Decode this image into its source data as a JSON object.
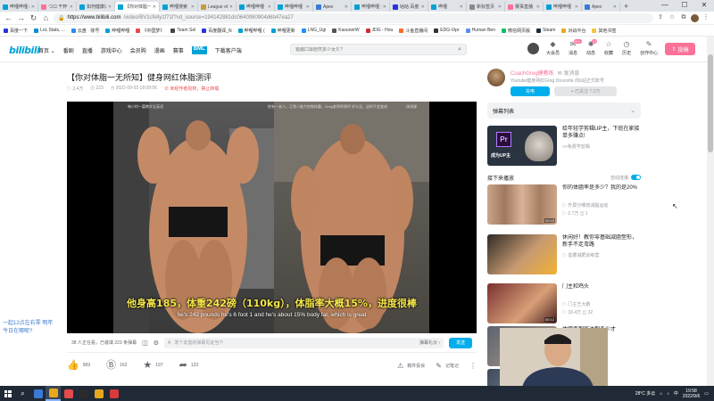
{
  "browser": {
    "tabs": [
      {
        "label": "哔哩哔哩 (゜-゜)つロ",
        "color": "#00a1d6"
      },
      {
        "label": "つロ 干杯~",
        "color": "#fb7299"
      },
      {
        "label": "如何健康过量减脂",
        "color": "#00a1d6"
      },
      {
        "label": "【你对体脂一无所知】健身网红体脂测评",
        "color": "#00a1d6",
        "active": true
      },
      {
        "label": "哔哩搜索",
        "color": "#00a1d6"
      },
      {
        "label": "League of Legend",
        "color": "#c89b3c"
      },
      {
        "label": "哔哩哔哩",
        "color": "#00a1d6"
      },
      {
        "label": "哔哩哔哩",
        "color": "#00a1d6"
      },
      {
        "label": "Apex",
        "color": "#3a7bd5"
      },
      {
        "label": "哔哩哔哩 好像",
        "color": "#00a1d6"
      },
      {
        "label": "咕咕 百度",
        "color": "#2932e1"
      },
      {
        "label": "哔哩",
        "color": "#00a1d6"
      },
      {
        "label": "新标签页",
        "color": "#888888"
      },
      {
        "label": "赛事直播",
        "color": "#fb7299"
      },
      {
        "label": "哔哩哔哩",
        "color": "#00a1d6"
      },
      {
        "label": "Apex",
        "color": "#3a7bd5"
      }
    ],
    "new_tab": "+",
    "window_controls": [
      "—",
      "☐",
      "✕"
    ],
    "url_host": "https://www.bilibili.com",
    "url_path": "/video/BV1cN4y1f71f?vd_source=194142881dc0640980904d6b47ea27",
    "bookmarks": [
      {
        "label": "百度一下",
        "color": "#2932e1"
      },
      {
        "label": "LoL Stats, ...",
        "color": "#0a8fd0"
      },
      {
        "label": "云盘 · 账号",
        "color": "#2d8cf0"
      },
      {
        "label": "哔哩哔哩",
        "color": "#00a1d6"
      },
      {
        "label": "《中国梦》",
        "color": "#e44b4b"
      },
      {
        "label": "Team Sel",
        "color": "#444444"
      },
      {
        "label": "百度翻译_N",
        "color": "#2932e1"
      },
      {
        "label": "哔哩哔哩 (",
        "color": "#00a1d6"
      },
      {
        "label": "哔哩更新",
        "color": "#00a1d6"
      },
      {
        "label": "LNG_Ugi",
        "color": "#1e90ff"
      },
      {
        "label": "KasunerW",
        "color": "#555555"
      },
      {
        "label": "JDG - Hou",
        "color": "#d0302f"
      },
      {
        "label": "斗鱼直播间",
        "color": "#f96a26"
      },
      {
        "label": "EDG-Vipr",
        "color": "#333333"
      },
      {
        "label": "Human Ben",
        "color": "#5b8ef0"
      },
      {
        "label": "微信网页版",
        "color": "#07c160"
      },
      {
        "label": "Steam",
        "color": "#1b2838"
      },
      {
        "label": "对战平台",
        "color": "#e8a81e"
      },
      {
        "label": "其他书签",
        "color": "#f4c542"
      }
    ]
  },
  "site": {
    "logo": "bilibili",
    "nav": [
      "首页 ⌄",
      "番剧",
      "直播",
      "游戏中心",
      "会员购",
      "漫画",
      "赛事",
      "BML",
      "下载客户端"
    ],
    "nav_highlight_index": 7,
    "search_placeholder": "错装口罩居然多少太久?",
    "header_icons": [
      {
        "label": "大会员",
        "icon": "vip-icon",
        "glyph": "◆"
      },
      {
        "label": "消息",
        "icon": "bell-icon",
        "glyph": "✉",
        "badge": "99+"
      },
      {
        "label": "动态",
        "icon": "dynamic-icon",
        "glyph": "✺",
        "badge": "22"
      },
      {
        "label": "收藏",
        "icon": "star-icon",
        "glyph": "☆"
      },
      {
        "label": "历史",
        "icon": "history-icon",
        "glyph": "◷"
      },
      {
        "label": "创作中心",
        "icon": "lightbulb-icon",
        "glyph": "✎"
      }
    ],
    "upload_label": "投稿"
  },
  "video": {
    "title": "【你对体脂一无所知】健身网红体脂测评",
    "views": "2.4万",
    "danmaku_count": "223",
    "date": "2022-09-03 18:09:06",
    "copyright": "未经作者授权，禁止转载",
    "watermark_left": "每小时一篇教学全英语",
    "watermark_center": "他有一米八，正常人能力控制体重，Greg老师将测评 好久没，这样不会变成",
    "watermark_right": "体测课",
    "subtitle_cn": "他身高185，体重242磅（110kg），体脂率大概15%，进度很棒",
    "subtitle_en": "he's 242 pounds he's 6 foot 1 and he's about 15% body fat, which is great",
    "watching": "38 人正在看，已装填 223 条弹幕",
    "danmaku_placeholder": "发个友善的弹幕见证当下",
    "etiquette": "弹幕礼仪 ›",
    "send": "发送",
    "likes": "969",
    "coins": "162",
    "favorites": "197",
    "shares": "123",
    "report": "稿件投诉",
    "note": "记笔记"
  },
  "side_text": "一起12点左右零 明年今日在哪呢?",
  "uploader": {
    "name": "CoachGreg健教练",
    "message": "✉ 发消息",
    "desc": "Youtube健身网红Greg Doucette 的b站正式账号",
    "charge": "充电",
    "follow": "+ 已关注 7.2万"
  },
  "right": {
    "danmaku_list": "弹幕列表",
    "ad": {
      "tag": "成为UP主",
      "title": "给年轻学剪辑UP主，下班在家接单多赚点!",
      "sub": "<>免费学剪辑"
    },
    "next_label": "接下来播放",
    "autoplay": "自动连播",
    "recs": [
      {
        "title": "你的体脂率是多少？我的是20%",
        "up": "▷ 升屏分哪管减脂运动",
        "stats": "▷ 2.7万  ◫ 1",
        "duration": "00:15"
      },
      {
        "title": "休闲好！教你零基础减脂塑形，新手不走弯路",
        "up": "▷ 善要减肥训练营",
        "stats": "",
        "duration": ""
      },
      {
        "title": "门主和鸡头",
        "up": "▷ 门主王大鹏",
        "stats": "▷ 33.4万  ◫ 32",
        "duration": "00:12"
      },
      {
        "title": "体脂率到底达到多少才",
        "up": "",
        "stats": "",
        "duration": ""
      },
      {
        "title": "青少年每18岁",
        "up": "",
        "stats": "",
        "duration": ""
      }
    ]
  },
  "taskbar": {
    "temp": "28°C 多云",
    "time": "19:58",
    "date": "2022/9/6",
    "lang": "中",
    "apps": [
      "#3a7bd5",
      "#e8a81e",
      "#e44b4b",
      "#2b2b2b",
      "#e8a81e",
      "#d83b3b"
    ]
  }
}
